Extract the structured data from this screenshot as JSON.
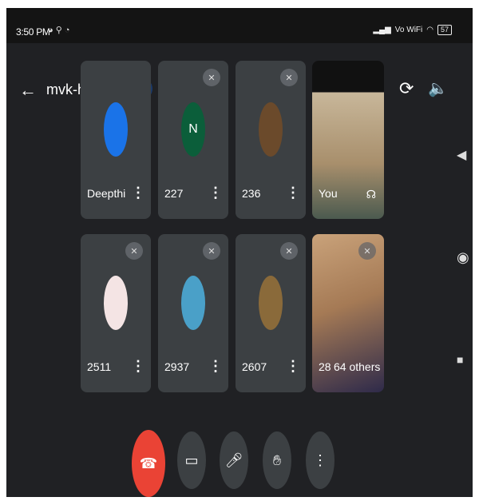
{
  "status_bar": {
    "time": "3:50 PM",
    "icons": "◕ ⚲ ◔",
    "network": "Vo WiFi",
    "battery": "57"
  },
  "header": {
    "meeting_code": "mvk-hjav-ggz"
  },
  "participants": [
    {
      "name": "Deepthi",
      "avatar_color": "#1a73e8"
    },
    {
      "name": "227",
      "avatar_letter": "N",
      "avatar_color": "#0b5e3a"
    },
    {
      "name": "236",
      "avatar_color": "#6b4a2b"
    },
    {
      "name": "You",
      "video": true
    },
    {
      "name": "2511",
      "avatar_color": "#f4e4e4"
    },
    {
      "name": "2937",
      "avatar_color": "#4aa0c8"
    },
    {
      "name": "2607",
      "avatar_color": "#8a6a3a"
    },
    {
      "name": "28",
      "overlay_text": "64 others",
      "video": true
    }
  ],
  "controls": [
    "end-call",
    "camera",
    "microphone",
    "raise-hand",
    "more-options"
  ],
  "colors": {
    "background": "#202124",
    "tile": "#3c4043",
    "end_call": "#ea4335",
    "active_speaker": "#1a3a6b"
  }
}
